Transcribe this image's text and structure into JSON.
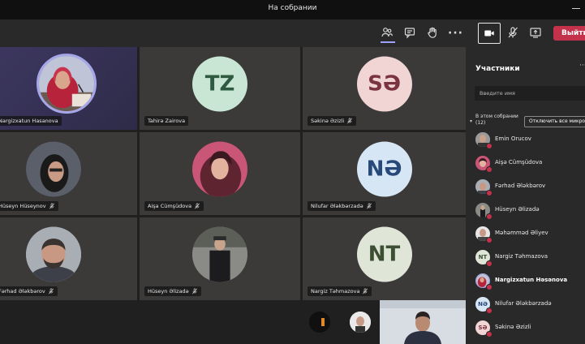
{
  "window": {
    "title": "На собрании"
  },
  "toolbar": {
    "leave_label": "Выйти",
    "icons": [
      "participants-icon",
      "chat-icon",
      "raise-hand-icon",
      "more-icon",
      "camera-icon",
      "mic-off-icon",
      "share-icon"
    ]
  },
  "tiles": [
    {
      "name": "Nargizxatun Hasanova",
      "type": "photo",
      "muted": false
    },
    {
      "name": "Tahirə Zairova",
      "type": "initials",
      "initials": "TZ",
      "bg": "#c8e6d3",
      "fg": "#2e5a3f",
      "muted": false
    },
    {
      "name": "Səkinə Əzizli",
      "type": "initials",
      "initials": "SƏ",
      "bg": "#f1d5d5",
      "fg": "#7a3340",
      "muted": true
    },
    {
      "name": "Hüseyn Hüseynov",
      "type": "photo",
      "muted": true
    },
    {
      "name": "Aişa Cümşüdova",
      "type": "photo",
      "muted": true
    },
    {
      "name": "Nilufar Ələkbərzadə",
      "type": "initials",
      "initials": "NƏ",
      "bg": "#d7e6f5",
      "fg": "#27497a",
      "muted": true
    },
    {
      "name": "Fərhad Ələkbərov",
      "type": "photo",
      "muted": true
    },
    {
      "name": "Hüseyn Əlizadə",
      "type": "photo",
      "muted": true
    },
    {
      "name": "Nargiz Təhmazova",
      "type": "initials",
      "initials": "NT",
      "bg": "#dfe6d8",
      "fg": "#3d4f33",
      "muted": true
    }
  ],
  "panel": {
    "title": "Участники",
    "search_placeholder": "Введите имя",
    "section_label": "В этом собрании",
    "section_count": "(12)",
    "mute_all_label": "Отключить все микрофоны",
    "participants": [
      {
        "name": "Emin Orucov",
        "avatar": "photo",
        "bold": false
      },
      {
        "name": "Aişə Cümşüdova",
        "avatar": "photo",
        "bold": false
      },
      {
        "name": "Fərhad Ələkbərov",
        "avatar": "photo",
        "bold": false
      },
      {
        "name": "Hüseyn Əlizadə",
        "avatar": "photo",
        "bold": false
      },
      {
        "name": "Məhəmməd Əliyev",
        "avatar": "photo",
        "bold": false
      },
      {
        "name": "Nargiz Təhmazova",
        "avatar": "initials",
        "initials": "NT",
        "bg": "#dfe6d8",
        "fg": "#3d4f33",
        "bold": false
      },
      {
        "name": "Nargizxatun Həsənova",
        "avatar": "photo",
        "bold": true
      },
      {
        "name": "Nilufar Ələkbərzadə",
        "avatar": "initials",
        "initials": "NƏ",
        "bg": "#d7e6f5",
        "fg": "#27497a",
        "bold": false
      },
      {
        "name": "Səkinə Əzizli",
        "avatar": "initials",
        "initials": "SƏ",
        "bg": "#f1d5d5",
        "fg": "#7a3340",
        "bold": false
      }
    ]
  },
  "colors": {
    "accent": "#9ea2ff",
    "leave": "#c4314b",
    "tile_bg": "#3b3a39",
    "panel_bg": "#292929"
  }
}
